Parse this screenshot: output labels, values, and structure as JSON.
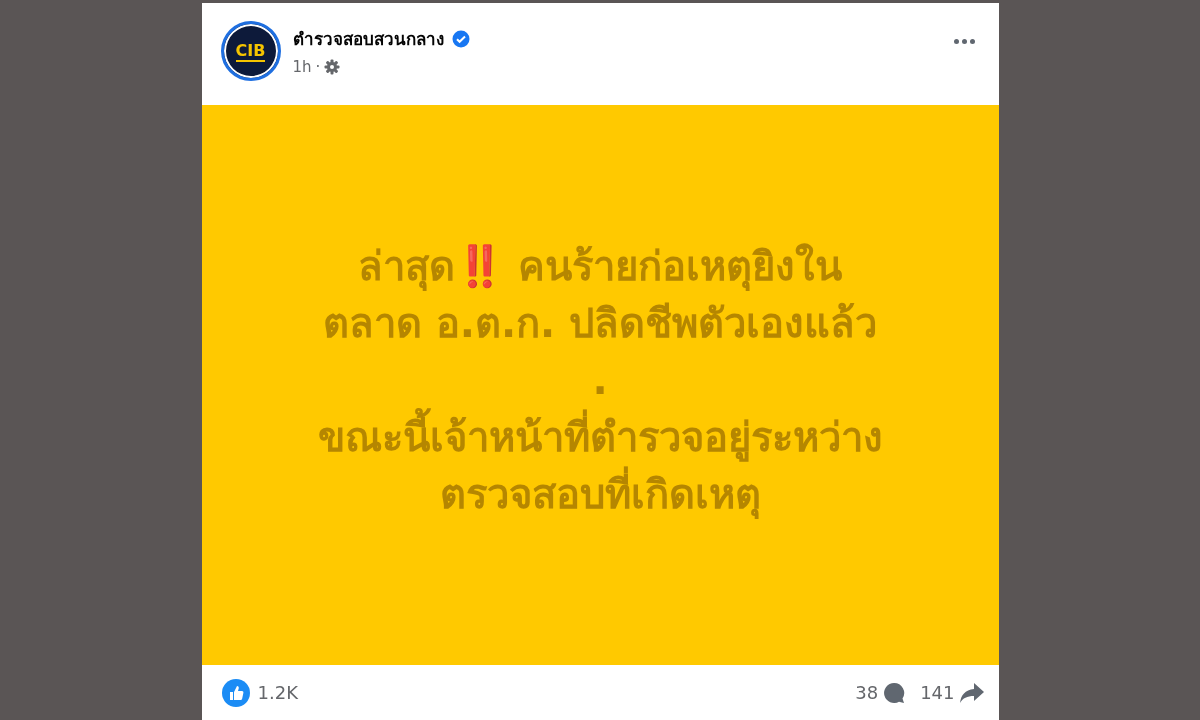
{
  "post": {
    "author": "ตำรวจสอบสวนกลาง",
    "avatar_text": "CIB",
    "verified": true,
    "time": "1h",
    "separator": "·",
    "body_lines": [
      {
        "before": "ล่าสุด",
        "emoji": "‼️",
        "after": " คนร้ายก่อเหตุยิงใน"
      },
      {
        "before": "ตลาด อ.ต.ก. ปลิดชีพตัวเองแล้ว"
      },
      {
        "before": "."
      },
      {
        "before": "ขณะนี้เจ้าหน้าที่ตำรวจอยู่ระหว่าง"
      },
      {
        "before": "ตรวจสอบที่เกิดเหตุ"
      }
    ],
    "reactions": "1.2K",
    "comments": "38",
    "shares": "141"
  }
}
